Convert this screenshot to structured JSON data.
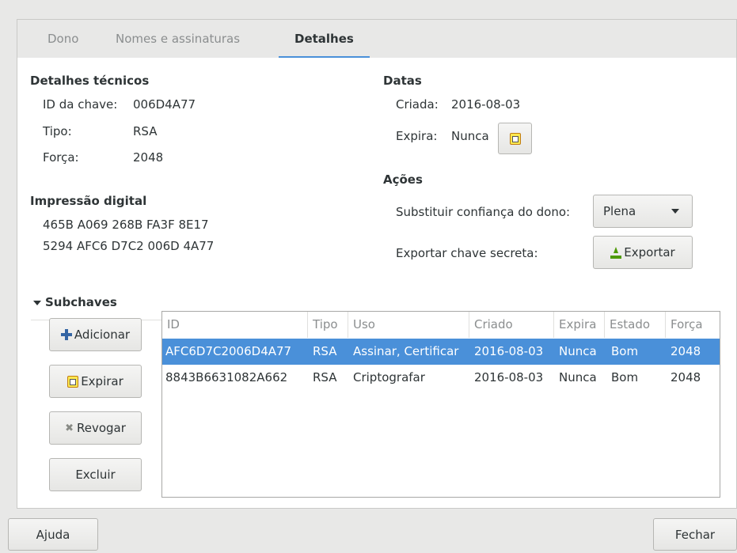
{
  "tabs": [
    {
      "label": "Dono"
    },
    {
      "label": "Nomes e assinaturas"
    },
    {
      "label": "Detalhes"
    }
  ],
  "technical": {
    "title": "Detalhes técnicos",
    "key_id_label": "ID da chave:",
    "key_id_value": "006D4A77",
    "type_label": "Tipo:",
    "type_value": "RSA",
    "strength_label": "Força:",
    "strength_value": "2048"
  },
  "fingerprint": {
    "title": "Impressão digital",
    "line1": "465B A069 268B FA3F 8E17",
    "line2": "5294 AFC6 D7C2 006D 4A77"
  },
  "dates": {
    "title": "Datas",
    "created_label": "Criada:",
    "created_value": "2016-08-03",
    "expires_label": "Expira:",
    "expires_value": "Nunca",
    "calendar_icon": "calendar-icon"
  },
  "actions": {
    "title": "Ações",
    "trust_label": "Substituir confiança do dono:",
    "trust_value": "Plena",
    "export_label": "Exportar chave secreta:",
    "export_button": "Exportar"
  },
  "subkeys": {
    "title": "Subchaves",
    "add_button": "Adicionar",
    "expire_button": "Expirar",
    "revoke_button": "Revogar",
    "delete_button": "Excluir",
    "columns": [
      "ID",
      "Tipo",
      "Uso",
      "Criado",
      "Expira",
      "Estado",
      "Força"
    ],
    "rows": [
      {
        "id": "AFC6D7C2006D4A77",
        "type": "RSA",
        "usage": "Assinar, Certificar",
        "created": "2016-08-03",
        "expires": "Nunca",
        "status": "Bom",
        "strength": "2048",
        "selected": true
      },
      {
        "id": "8843B6631082A662",
        "type": "RSA",
        "usage": "Criptografar",
        "created": "2016-08-03",
        "expires": "Nunca",
        "status": "Bom",
        "strength": "2048",
        "selected": false
      }
    ]
  },
  "footer": {
    "help_button": "Ajuda",
    "close_button": "Fechar"
  },
  "colors": {
    "accent": "#4a90d9",
    "window_bg": "#e8e8e7"
  }
}
